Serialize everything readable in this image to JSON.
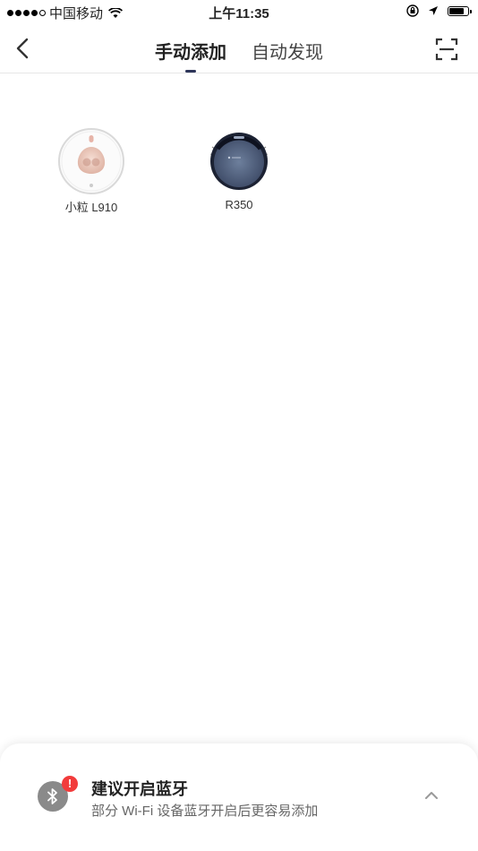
{
  "status_bar": {
    "carrier": "中国移动",
    "time": "上午11:35",
    "signal_icon": "signal-dots-icon",
    "wifi_icon": "wifi-icon",
    "lock_icon": "orientation-lock-icon",
    "location_icon": "location-arrow-icon",
    "battery_icon": "battery-icon"
  },
  "nav": {
    "back_icon": "chevron-left-icon",
    "tabs": [
      {
        "label": "手动添加",
        "active": true
      },
      {
        "label": "自动发现",
        "active": false
      }
    ],
    "scan_icon": "scan-icon",
    "accent": "#2d3559"
  },
  "devices": [
    {
      "label": "小粒 L910",
      "icon": "robot-l910-image"
    },
    {
      "label": "R350",
      "icon": "robot-r350-image"
    }
  ],
  "bottom_sheet": {
    "title": "建议开启蓝牙",
    "subtitle": "部分 Wi-Fi 设备蓝牙开启后更容易添加",
    "icon": "bluetooth-icon",
    "badge": "!",
    "badge_color": "#f23b3b",
    "chevron_icon": "chevron-up-icon"
  }
}
